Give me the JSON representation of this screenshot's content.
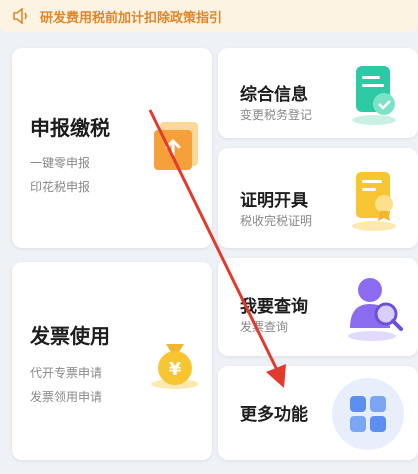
{
  "notice": {
    "text": "研发费用税前加计扣除政策指引",
    "icon": "speaker-icon"
  },
  "cards": {
    "declare": {
      "title": "申报缴税",
      "items": [
        "一键零申报",
        "印花税申报"
      ],
      "icon": "upload-folder-icon"
    },
    "invoice": {
      "title": "发票使用",
      "items": [
        "代开专票申请",
        "发票领用申请"
      ],
      "icon": "money-bag-icon"
    },
    "info": {
      "title": "综合信息",
      "subtitle": "变更税务登记",
      "icon": "document-check-icon"
    },
    "cert": {
      "title": "证明开具",
      "subtitle": "税收完税证明",
      "icon": "certificate-icon"
    },
    "query": {
      "title": "我要查询",
      "subtitle": "发票查询",
      "icon": "user-search-icon"
    },
    "more": {
      "title": "更多功能",
      "icon": "grid-icon"
    }
  },
  "colors": {
    "accent_orange": "#e0862a",
    "arrow_red": "#e23b2e",
    "teal": "#2cc9a4",
    "yellow": "#f7c531",
    "purple": "#8b6cf0"
  }
}
